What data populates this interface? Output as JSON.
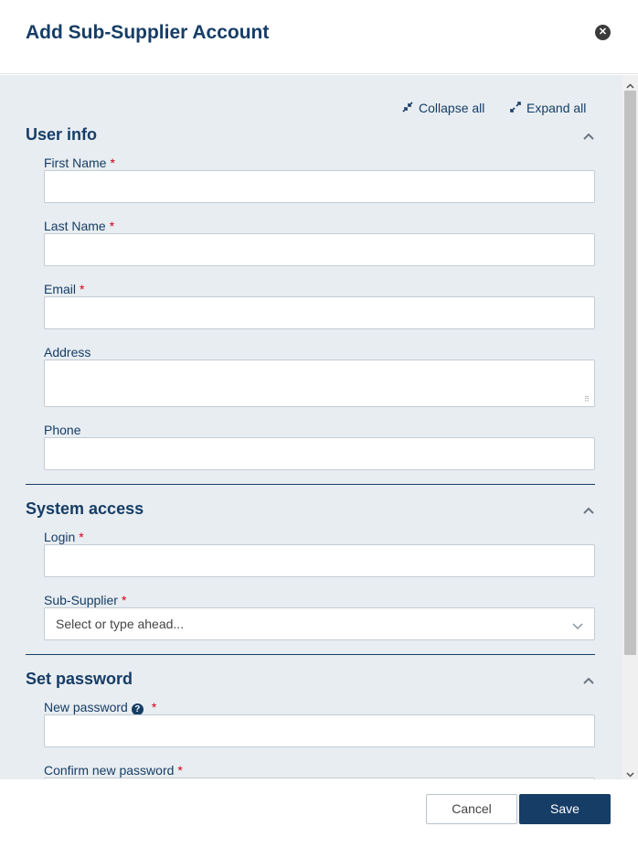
{
  "dialog": {
    "title": "Add Sub-Supplier Account",
    "close_icon": "close-circle-icon"
  },
  "toolbar": {
    "collapse_all": "Collapse all",
    "expand_all": "Expand all"
  },
  "sections": {
    "user_info": {
      "title": "User info",
      "first_name_label": "First Name",
      "last_name_label": "Last Name",
      "email_label": "Email",
      "address_label": "Address",
      "phone_label": "Phone",
      "first_name_value": "",
      "last_name_value": "",
      "email_value": "",
      "address_value": "",
      "phone_value": ""
    },
    "system_access": {
      "title": "System access",
      "login_label": "Login",
      "login_value": "",
      "sub_supplier_label": "Sub-Supplier",
      "sub_supplier_placeholder": "Select or type ahead..."
    },
    "set_password": {
      "title": "Set password",
      "new_password_label": "New password",
      "confirm_password_label": "Confirm new password",
      "new_password_value": ""
    }
  },
  "required_marker": "*",
  "help_glyph": "?",
  "footer": {
    "cancel_label": "Cancel",
    "save_label": "Save"
  },
  "colors": {
    "primary": "#163d66",
    "required": "#d0021b",
    "panel_bg": "#e8edf1"
  }
}
